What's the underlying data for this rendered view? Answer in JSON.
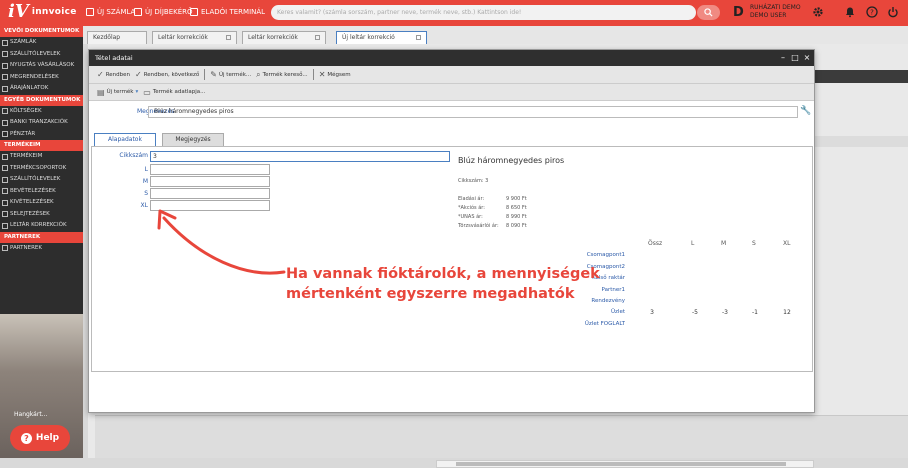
{
  "app": {
    "brand": "innvoice",
    "logo_mark": "iV",
    "top_links": [
      "ÚJ SZÁMLA",
      "ÚJ DÍJBEKÉRŐ",
      "ELADÓI TERMINÁL"
    ],
    "search_placeholder": "Keres valamit? (számla sorszám, partner neve, termék neve, stb.) Kattintson ide!",
    "user_initial": "D",
    "user_line1": "RUHÁZATI DEMO",
    "user_line2": "DEMO USER",
    "accent_color": "#e8463b"
  },
  "sidebar": {
    "sections": [
      {
        "title": "VEVŐI DOKUMENTUMOK",
        "items": [
          "SZÁMLÁK",
          "SZÁLLÍTÓLEVELEK",
          "NYUGTÁS VÁSÁRLÁSOK",
          "MEGRENDELÉSEK",
          "ÁRAJÁNLATOK"
        ]
      },
      {
        "title": "EGYÉB DOKUMENTUMOK",
        "items": [
          "KÖLTSÉGEK",
          "BANKI TRANZAKCIÓK",
          "PÉNZTÁR"
        ]
      },
      {
        "title": "TERMÉKEIM",
        "items": [
          "TERMÉKEIM",
          "TERMÉKCSOPORTOK",
          "SZÁLLÍTÓLEVELEK",
          "BEVÉTELEZÉSEK",
          "KIVÉTELEZÉSEK",
          "SELEJTEZÉSEK",
          "LELTÁR KORREKCIÓK"
        ]
      },
      {
        "title": "PARTNEREK",
        "items": [
          "PARTNEREK"
        ]
      }
    ],
    "hangkartya": "Hangkárt...",
    "help_label": "Help"
  },
  "tabs": [
    {
      "label": "Kezdőlap"
    },
    {
      "label": "Leltár korrekciók"
    },
    {
      "label": "Leltár korrekciók"
    },
    {
      "label": "Új leltár korrekció"
    }
  ],
  "dialog": {
    "title": "Tétel adatai",
    "toolbar1": [
      "Rendben",
      "Rendben, következő",
      "Új termék...",
      "Termék kereső...",
      "Mégsem"
    ],
    "toolbar2": [
      "Új termék",
      "Termék adatlapja..."
    ],
    "megnevezes_label": "Megnevezés",
    "megnevezes_value": "Blúz háromnegyedes piros",
    "form_tabs": [
      "Alapadatok",
      "Megjegyzés"
    ],
    "fields": [
      {
        "label": "Cikkszám",
        "value": "3"
      },
      {
        "label": "L",
        "value": ""
      },
      {
        "label": "M",
        "value": ""
      },
      {
        "label": "S",
        "value": ""
      },
      {
        "label": "XL",
        "value": ""
      }
    ],
    "info": {
      "title": "Blúz háromnegyedes piros",
      "cikkszam": "Cikkszám: 3",
      "prices": [
        {
          "label": "Eladási ár:",
          "value": "9 900 Ft"
        },
        {
          "label": "*Akciós ár:",
          "value": "8 650 Ft"
        },
        {
          "label": "*UNAS ár:",
          "value": "8 990 Ft"
        },
        {
          "label": "Törzsvásárlói ár:",
          "value": "8 090 Ft"
        }
      ]
    },
    "stock": {
      "headers": [
        "Össz",
        "L",
        "M",
        "S",
        "XL"
      ],
      "rows": [
        {
          "label": "Csomagpont1",
          "values": [
            "",
            "",
            "",
            "",
            ""
          ]
        },
        {
          "label": "Csomagpont2",
          "values": [
            "",
            "",
            "",
            "",
            ""
          ]
        },
        {
          "label": "Külső raktár",
          "values": [
            "",
            "",
            "",
            "",
            ""
          ]
        },
        {
          "label": "Partner1",
          "values": [
            "",
            "",
            "",
            "",
            ""
          ]
        },
        {
          "label": "Rendezvény",
          "values": [
            "",
            "",
            "",
            "",
            ""
          ]
        },
        {
          "label": "Üzlet",
          "values": [
            "3",
            "-5",
            "-3",
            "-1",
            "12"
          ]
        },
        {
          "label": "Üzlet FOGLALT",
          "values": [
            "",
            "",
            "",
            "",
            ""
          ]
        }
      ]
    }
  },
  "callout": {
    "line1": "Ha vannak fióktárolók, a mennyiségek",
    "line2": "mértenként egyszerre megadhatók"
  }
}
